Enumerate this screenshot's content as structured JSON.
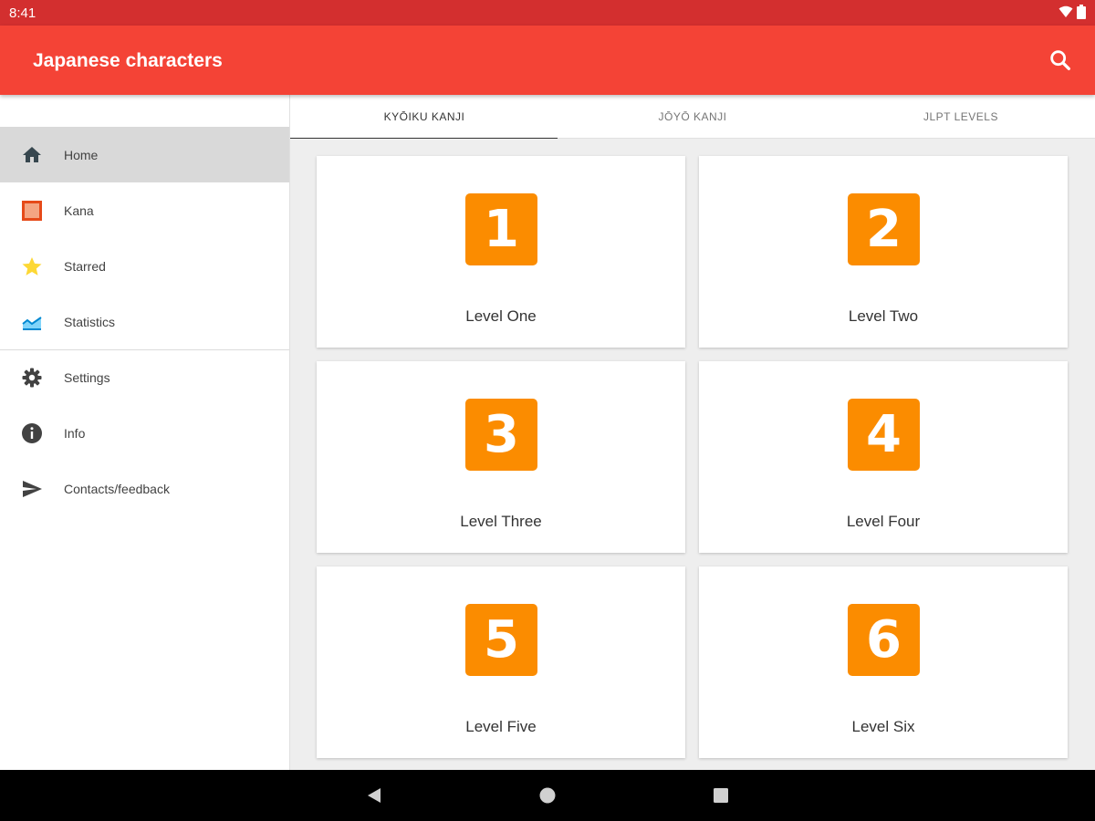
{
  "status_bar": {
    "time": "8:41"
  },
  "app_bar": {
    "title": "Japanese characters"
  },
  "drawer": {
    "items": [
      {
        "label": "Home",
        "icon": "home-icon"
      },
      {
        "label": "Kana",
        "icon": "kana-square-icon"
      },
      {
        "label": "Starred",
        "icon": "star-icon"
      },
      {
        "label": "Statistics",
        "icon": "statistics-icon"
      },
      {
        "label": "Settings",
        "icon": "gear-icon"
      },
      {
        "label": "Info",
        "icon": "info-icon"
      },
      {
        "label": "Contacts/feedback",
        "icon": "send-icon"
      }
    ]
  },
  "tabs": [
    {
      "label": "KYŌIKU KANJI"
    },
    {
      "label": "JŌYŌ KANJI"
    },
    {
      "label": "JLPT LEVELS"
    }
  ],
  "levels": [
    {
      "number": "1",
      "label": "Level One"
    },
    {
      "number": "2",
      "label": "Level Two"
    },
    {
      "number": "3",
      "label": "Level Three"
    },
    {
      "number": "4",
      "label": "Level Four"
    },
    {
      "number": "5",
      "label": "Level Five"
    },
    {
      "number": "6",
      "label": "Level Six"
    }
  ],
  "colors": {
    "status_bar": "#d32f2f",
    "app_bar": "#f44336",
    "badge": "#fb8c00",
    "active_nav": "#d9d9d9"
  }
}
